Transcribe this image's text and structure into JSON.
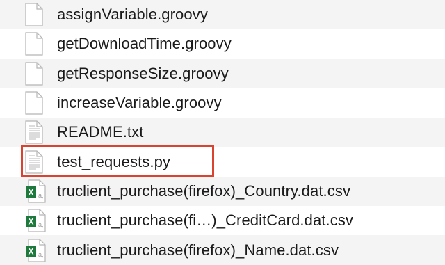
{
  "files": [
    {
      "name": "assignVariable.groovy",
      "icon": "blank-document-icon"
    },
    {
      "name": "getDownloadTime.groovy",
      "icon": "blank-document-icon"
    },
    {
      "name": "getResponseSize.groovy",
      "icon": "blank-document-icon"
    },
    {
      "name": "increaseVariable.groovy",
      "icon": "blank-document-icon"
    },
    {
      "name": "README.txt",
      "icon": "text-document-icon"
    },
    {
      "name": "test_requests.py",
      "icon": "text-document-icon",
      "highlighted": true
    },
    {
      "name": "truclient_purchase(firefox)_Country.dat.csv",
      "icon": "excel-csv-icon"
    },
    {
      "name": "truclient_purchase(fi…)_CreditCard.dat.csv",
      "icon": "excel-csv-icon"
    },
    {
      "name": "truclient_purchase(firefox)_Name.dat.csv",
      "icon": "excel-csv-icon"
    }
  ],
  "colors": {
    "highlight_border": "#d9432f",
    "excel_green": "#1e7a3c",
    "row_stripe": "#f4f4f4"
  }
}
